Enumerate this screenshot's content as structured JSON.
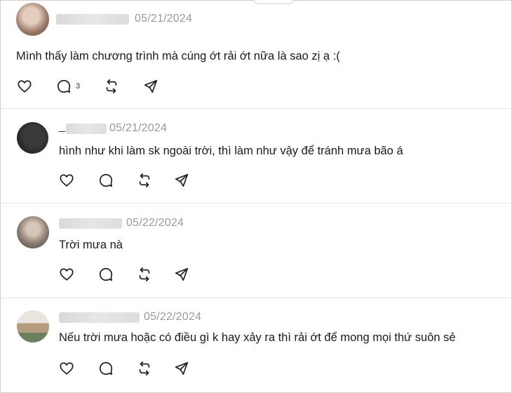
{
  "posts": [
    {
      "date": "05/21/2024",
      "text": "Mình thấy làm chương trình mà cúng ớt rải ớt nữa là sao zị ạ :(",
      "reply_count": "3",
      "avatar_color": "#b79580"
    },
    {
      "name_prefix": "_",
      "date": "05/21/2024",
      "text": "hình như khi làm sk ngoài trời, thì làm như vậy để tránh mưa bão á",
      "avatar_color": "#2b2b2b"
    },
    {
      "date": "05/22/2024",
      "text": "Trời mưa nà",
      "avatar_color": "#8d7f74"
    },
    {
      "date": "05/22/2024",
      "text": "Nếu trời mưa hoặc có điều gì k hay xảy ra thì rải ớt để mong mọi thứ suôn sẻ",
      "avatar_color": "#a79b86"
    }
  ],
  "icons": {
    "like": "heart-icon",
    "comment": "comment-icon",
    "repost": "repost-icon",
    "share": "send-icon"
  }
}
